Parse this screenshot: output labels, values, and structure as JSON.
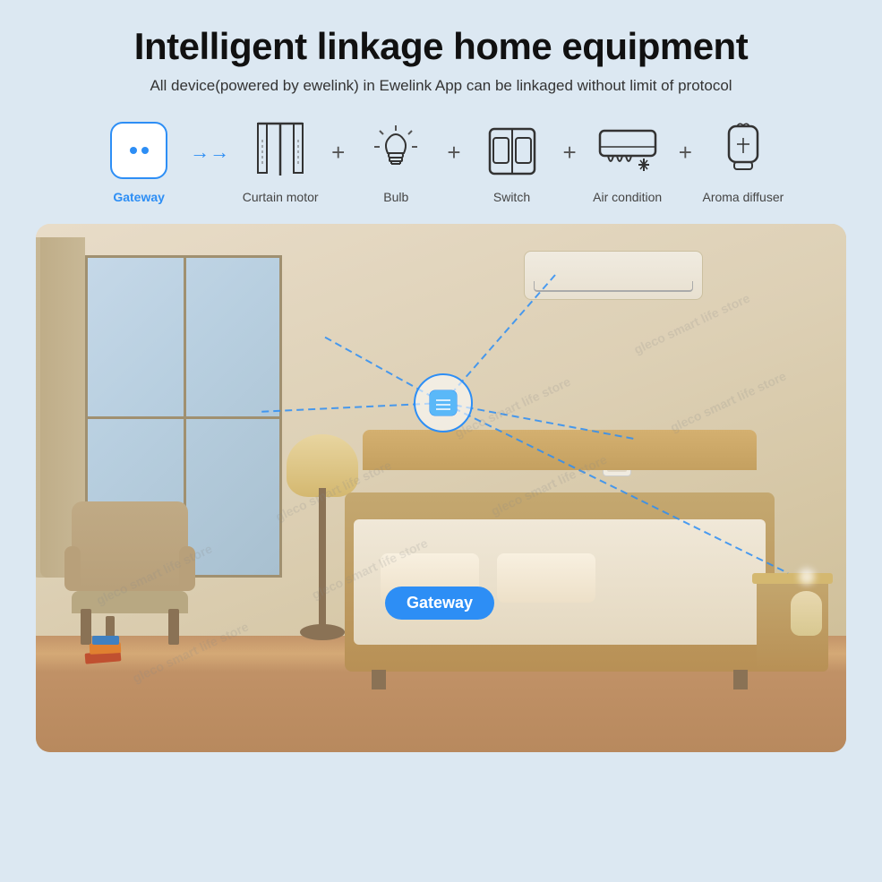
{
  "page": {
    "title": "Intelligent linkage home equipment",
    "subtitle": "All device(powered by ewelink) in Ewelink App can be linkaged without limit of protocol"
  },
  "devices": [
    {
      "id": "gateway",
      "label": "Gateway",
      "labelClass": "blue"
    },
    {
      "id": "curtain",
      "label": "Curtain motor"
    },
    {
      "id": "bulb",
      "label": "Bulb"
    },
    {
      "id": "switch",
      "label": "Switch"
    },
    {
      "id": "ac",
      "label": "Air condition"
    },
    {
      "id": "aroma",
      "label": "Aroma diffuser"
    }
  ],
  "room": {
    "gateway_label": "Gateway"
  },
  "colors": {
    "blue": "#2d8ef5",
    "text_dark": "#111111",
    "text_mid": "#333333",
    "bg": "#dce8f2"
  }
}
